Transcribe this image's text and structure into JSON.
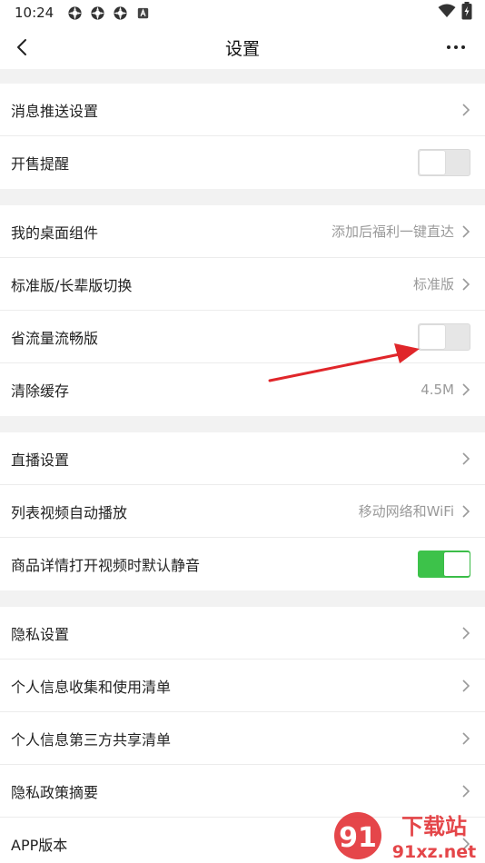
{
  "status_bar": {
    "time": "10:24",
    "icons": [
      "gear-icon",
      "gear-icon",
      "gear-icon",
      "a-icon"
    ],
    "right_icons": [
      "wifi-icon",
      "battery-icon"
    ]
  },
  "nav": {
    "title": "设置",
    "back_icon": "back-icon",
    "more_icon": "more-icon"
  },
  "groups": [
    {
      "rows": [
        {
          "label": "消息推送设置",
          "type": "chevron"
        },
        {
          "label": "开售提醒",
          "type": "toggle",
          "on": false
        }
      ]
    },
    {
      "rows": [
        {
          "label": "我的桌面组件",
          "value": "添加后福利一键直达",
          "type": "chevron"
        },
        {
          "label": "标准版/长辈版切换",
          "value": "标准版",
          "type": "chevron"
        },
        {
          "label": "省流量流畅版",
          "type": "toggle",
          "on": false
        },
        {
          "label": "清除缓存",
          "value": "4.5M",
          "type": "chevron"
        }
      ]
    },
    {
      "rows": [
        {
          "label": "直播设置",
          "type": "chevron"
        },
        {
          "label": "列表视频自动播放",
          "value": "移动网络和WiFi",
          "type": "chevron"
        },
        {
          "label": "商品详情打开视频时默认静音",
          "type": "toggle",
          "on": true
        }
      ]
    },
    {
      "rows": [
        {
          "label": "隐私设置",
          "type": "chevron"
        },
        {
          "label": "个人信息收集和使用清单",
          "type": "chevron"
        },
        {
          "label": "个人信息第三方共享清单",
          "type": "chevron"
        },
        {
          "label": "隐私政策摘要",
          "type": "chevron"
        },
        {
          "label": "APP版本",
          "type": "chevron"
        }
      ]
    }
  ],
  "colors": {
    "toggle_on": "#3dc24a",
    "arrow": "#e0262a"
  },
  "watermark": {
    "logo": "91下载站",
    "url": "91xz.net"
  }
}
